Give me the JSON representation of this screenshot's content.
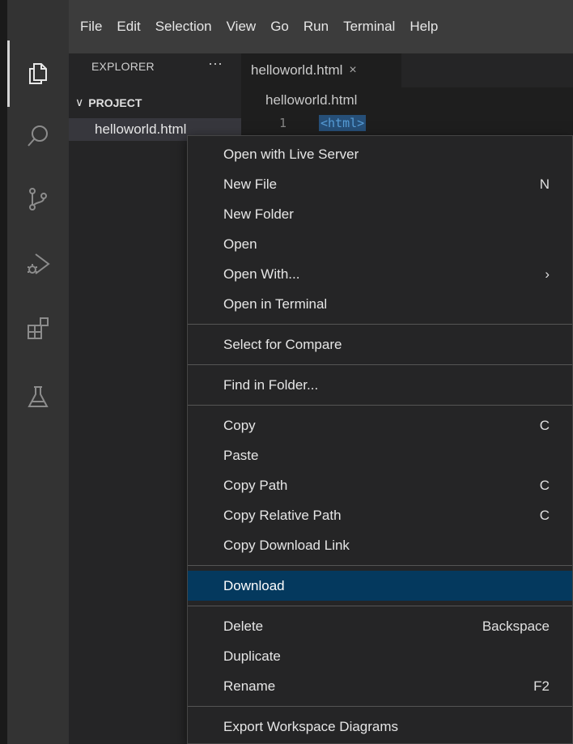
{
  "menubar": {
    "items": [
      "File",
      "Edit",
      "Selection",
      "View",
      "Go",
      "Run",
      "Terminal",
      "Help"
    ]
  },
  "activity_bar": {
    "icons": [
      "files-icon",
      "search-icon",
      "source-control-icon",
      "run-debug-icon",
      "extensions-icon",
      "testing-icon"
    ]
  },
  "sidebar": {
    "title": "EXPLORER",
    "more": "···",
    "project_chevron": "∨",
    "project_label": "PROJECT",
    "file_name": "helloworld.html"
  },
  "editor": {
    "tab_label": "helloworld.html",
    "tab_close": "×",
    "breadcrumb": "helloworld.html",
    "line_number": "1",
    "code": "<html>"
  },
  "context_menu": {
    "groups": [
      [
        {
          "label": "Open with Live Server",
          "shortcut": ""
        },
        {
          "label": "New File",
          "shortcut": "N"
        },
        {
          "label": "New Folder",
          "shortcut": ""
        },
        {
          "label": "Open",
          "shortcut": ""
        },
        {
          "label": "Open With...",
          "shortcut": "›"
        },
        {
          "label": "Open in Terminal",
          "shortcut": ""
        }
      ],
      [
        {
          "label": "Select for Compare",
          "shortcut": ""
        }
      ],
      [
        {
          "label": "Find in Folder...",
          "shortcut": ""
        }
      ],
      [
        {
          "label": "Copy",
          "shortcut": "C"
        },
        {
          "label": "Paste",
          "shortcut": ""
        },
        {
          "label": "Copy Path",
          "shortcut": "C"
        },
        {
          "label": "Copy Relative Path",
          "shortcut": "C"
        },
        {
          "label": "Copy Download Link",
          "shortcut": ""
        }
      ],
      [
        {
          "label": "Download",
          "shortcut": "",
          "active": true
        }
      ],
      [
        {
          "label": "Delete",
          "shortcut": "Backspace"
        },
        {
          "label": "Duplicate",
          "shortcut": ""
        },
        {
          "label": "Rename",
          "shortcut": "F2"
        }
      ],
      [
        {
          "label": "Export Workspace Diagrams",
          "shortcut": ""
        }
      ]
    ]
  },
  "colors": {
    "accent_selection": "#04395e",
    "code_tag": "#569cd6"
  }
}
